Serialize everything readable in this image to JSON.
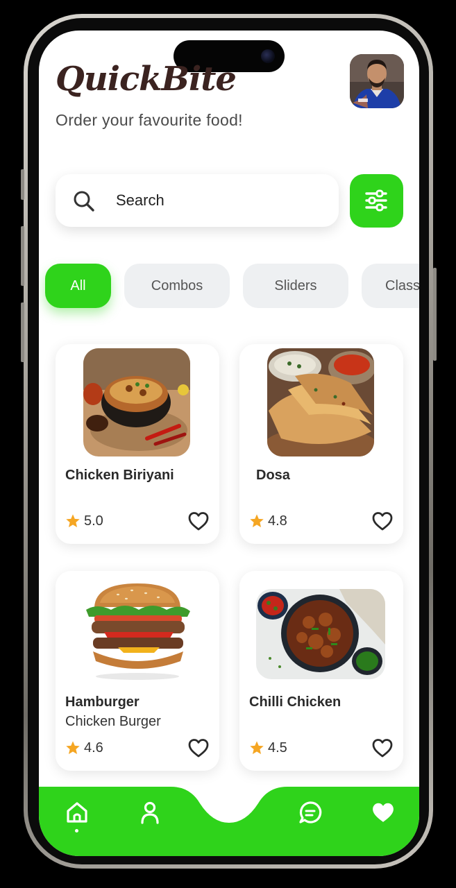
{
  "app": {
    "title": "QuickBite",
    "subtitle": "Order your favourite food!"
  },
  "search": {
    "placeholder": "Search"
  },
  "categories": [
    {
      "label": "All",
      "active": true
    },
    {
      "label": "Combos",
      "active": false
    },
    {
      "label": "Sliders",
      "active": false
    },
    {
      "label": "Class",
      "active": false
    }
  ],
  "products": [
    {
      "name": "Chicken Biriyani",
      "subtitle": "",
      "rating": "5.0"
    },
    {
      "name": "Dosa",
      "subtitle": "",
      "rating": "4.8"
    },
    {
      "name": "Hamburger",
      "subtitle": "Chicken Burger",
      "rating": "4.6"
    },
    {
      "name": "Chilli Chicken",
      "subtitle": "",
      "rating": "4.5"
    }
  ],
  "nav": {
    "items": [
      "home-icon",
      "profile-icon",
      "chat-icon",
      "favorites-icon"
    ],
    "active": "home-icon"
  },
  "colors": {
    "accent": "#2fd31b",
    "star": "#f5a623",
    "logo": "#3b2320"
  }
}
